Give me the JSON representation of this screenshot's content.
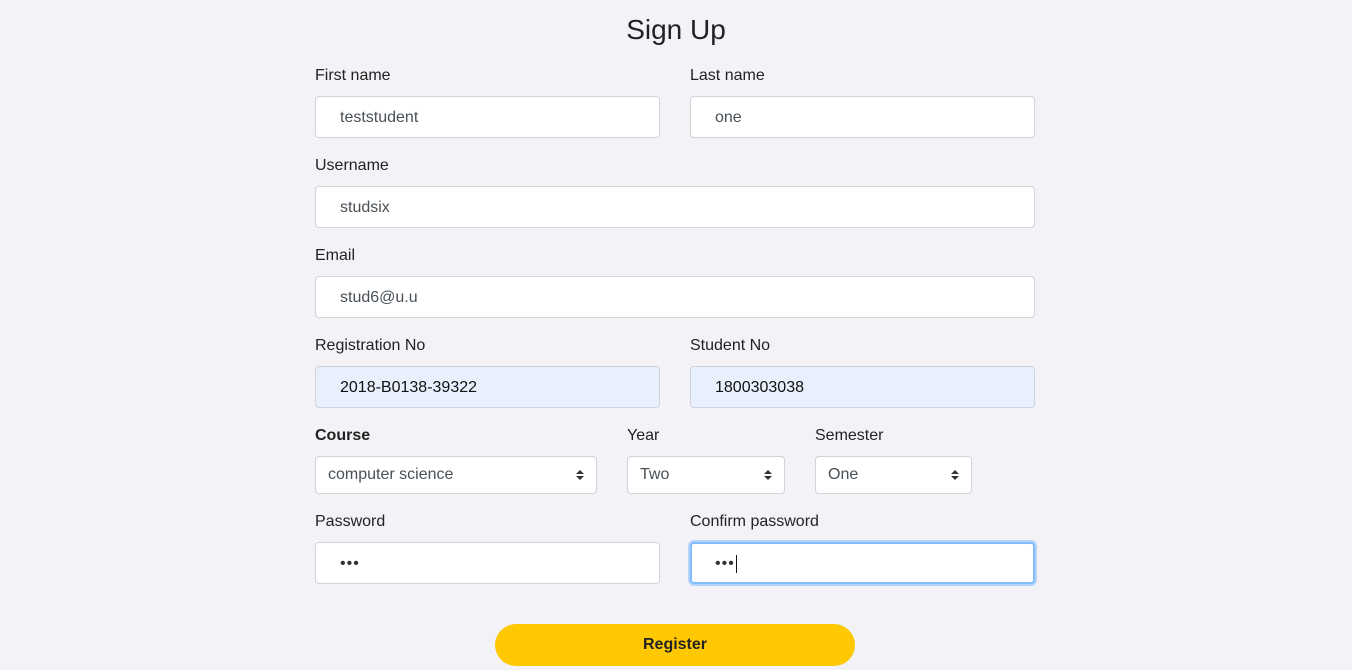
{
  "page": {
    "title": "Sign Up"
  },
  "form": {
    "first_name": {
      "label": "First name",
      "value": "teststudent"
    },
    "last_name": {
      "label": "Last name",
      "value": "one"
    },
    "username": {
      "label": "Username",
      "value": "studsix"
    },
    "email": {
      "label": "Email",
      "value": "stud6@u.u"
    },
    "registration_no": {
      "label": "Registration No",
      "value": "2018-B0138-39322"
    },
    "student_no": {
      "label": "Student No",
      "value": "1800303038"
    },
    "course": {
      "label": "Course",
      "selected": "computer science"
    },
    "year": {
      "label": "Year",
      "selected": "Two"
    },
    "semester": {
      "label": "Semester",
      "selected": "One"
    },
    "password": {
      "label": "Password",
      "value": "•••"
    },
    "confirm_password": {
      "label": "Confirm password",
      "value": "•••"
    },
    "register_label": "Register"
  },
  "colors": {
    "background": "#f3f2f7",
    "accent_button": "#ffc800",
    "autofill_bg": "#e8f0fe",
    "focus_border": "#80bdff"
  }
}
